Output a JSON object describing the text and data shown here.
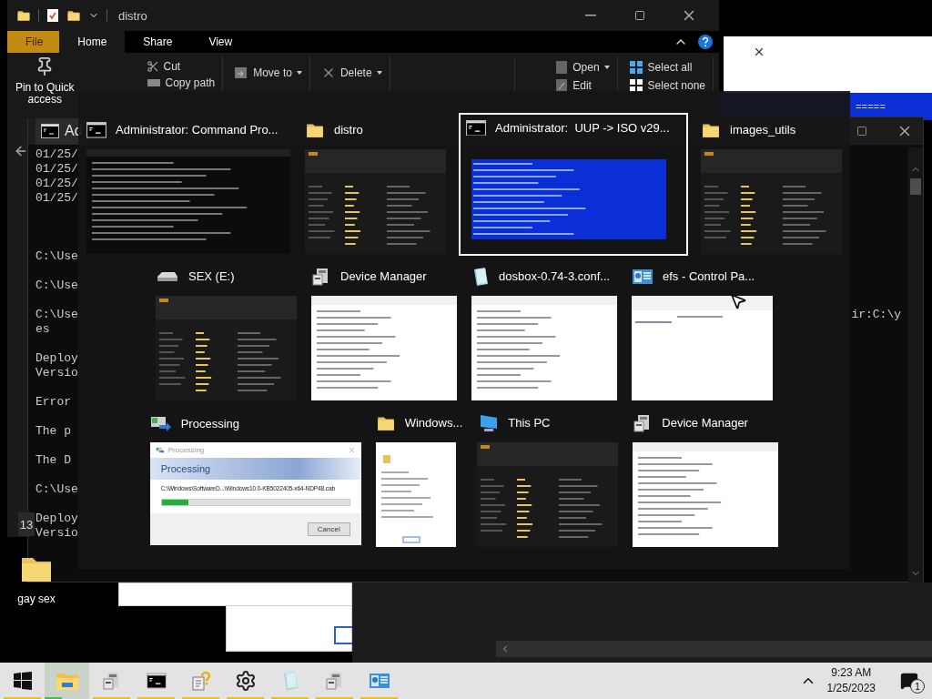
{
  "explorer_window": {
    "title": "distro",
    "ribbon_tabs": [
      {
        "label": "File",
        "kind": "menu",
        "selected": false
      },
      {
        "label": "Home",
        "kind": "tab",
        "selected": true
      },
      {
        "label": "Share",
        "kind": "tab",
        "selected": false
      },
      {
        "label": "View",
        "kind": "tab",
        "selected": false
      }
    ],
    "clipboard": {
      "pin": "Pin to Quick access",
      "cut": "Cut",
      "copy_path": "Copy path"
    },
    "organize": {
      "move_to": "Move to",
      "delete": "Delete"
    },
    "open_group": {
      "open": "Open",
      "edit": "Edit"
    },
    "select_group": {
      "select_all": "Select all",
      "select_none": "Select none"
    }
  },
  "console_window": {
    "title": "Ad",
    "blocks": [
      [
        "01/25/",
        "01/25/",
        "01/25/",
        "01/25/"
      ],
      [
        "C:\\Use"
      ],
      [
        "C:\\Use"
      ],
      [
        "C:\\Use",
        "es"
      ],
      [
        "Deploy",
        "Versio"
      ],
      [
        "Error"
      ],
      [
        "The p"
      ],
      [
        "The D"
      ],
      [
        "C:\\Use"
      ],
      [
        "Deploy",
        "Versio"
      ]
    ],
    "right_fragment": "ir:C:\\y",
    "side_badge": "13"
  },
  "blue_window": {
    "fragment": "====="
  },
  "task_switcher": {
    "items": [
      {
        "title": "Administrator: Command Pro...",
        "kind": "console",
        "preview": {
          "kind": "console"
        },
        "selected": false
      },
      {
        "title": "distro",
        "kind": "folder",
        "preview": {
          "kind": "explorer"
        },
        "selected": false
      },
      {
        "title": "Administrator:  UUP -> ISO v29...",
        "kind": "console",
        "preview": {
          "kind": "blueconsole"
        },
        "selected": true
      },
      {
        "title": "images_utils",
        "kind": "folder",
        "preview": {
          "kind": "explorer"
        },
        "selected": false
      },
      {
        "title": "SEX (E:)",
        "kind": "drive",
        "preview": {
          "kind": "explorer"
        },
        "selected": false
      },
      {
        "title": "Device Manager",
        "kind": "devices",
        "preview": {
          "kind": "document"
        },
        "selected": false
      },
      {
        "title": "dosbox-0.74-3.conf...",
        "kind": "notepad",
        "preview": {
          "kind": "document"
        },
        "selected": false
      },
      {
        "title": "efs - Control Pa...",
        "kind": "control",
        "preview": {
          "kind": "browser"
        },
        "selected": false
      },
      {
        "title": "Processing",
        "kind": "processing",
        "preview": {
          "kind": "dialog"
        },
        "selected": false,
        "dialog": {
          "title": "Processing",
          "heading": "Processing",
          "path": "C:\\Windows\\SoftwareD...\\Windows10.0-KB5022405-x64-NDP48.cab",
          "level": 0.14,
          "button": "Cancel"
        }
      },
      {
        "title": "Windows...",
        "kind": "folder",
        "preview": {
          "kind": "properties"
        },
        "selected": false
      },
      {
        "title": "This PC",
        "kind": "computer",
        "preview": {
          "kind": "explorer"
        },
        "selected": false
      },
      {
        "title": "Device Manager",
        "kind": "devices",
        "preview": {
          "kind": "document"
        },
        "selected": false
      }
    ]
  },
  "desktop_icons": [
    {
      "label": "gay sex"
    }
  ],
  "taskbar": {
    "apps": [
      {
        "kind": "explorer",
        "active": true
      },
      {
        "kind": "devices",
        "active": false
      },
      {
        "kind": "console",
        "active": false
      },
      {
        "kind": "help",
        "active": false
      },
      {
        "kind": "settings",
        "active": false
      },
      {
        "kind": "notepad",
        "active": false
      },
      {
        "kind": "devices",
        "active": false
      },
      {
        "kind": "control",
        "active": false
      }
    ],
    "time": "9:23 AM",
    "date": "1/25/2023",
    "notification_count": "1"
  }
}
